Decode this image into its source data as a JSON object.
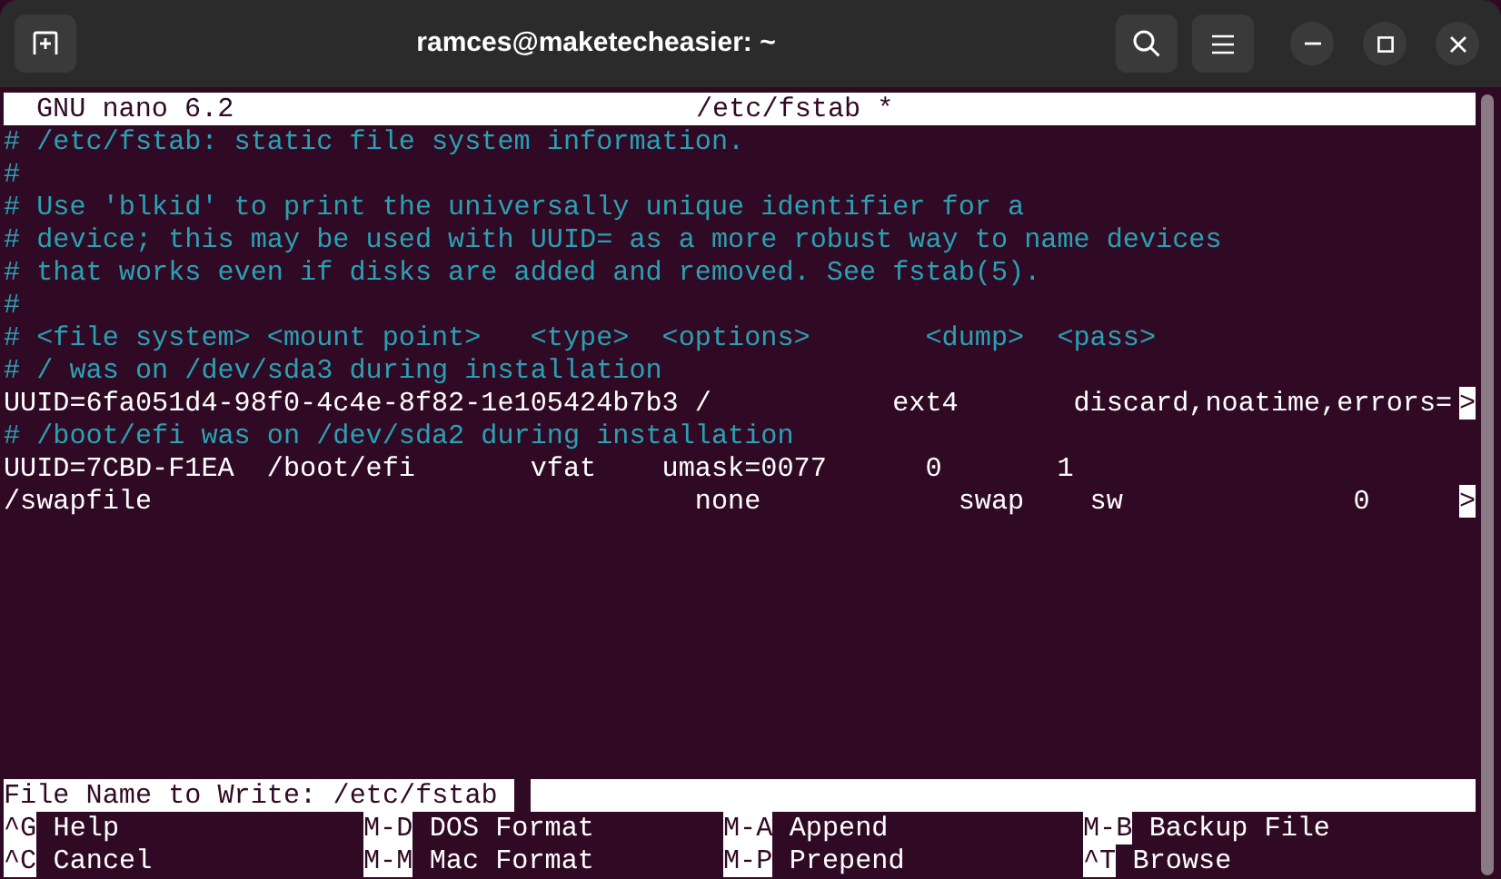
{
  "window": {
    "title": "ramces@maketecheasier: ~"
  },
  "nano": {
    "version": "GNU nano 6.2",
    "filename": "/etc/fstab *"
  },
  "lines": [
    {
      "kind": "comment",
      "text": "# /etc/fstab: static file system information."
    },
    {
      "kind": "comment",
      "text": "#"
    },
    {
      "kind": "comment",
      "text": "# Use 'blkid' to print the universally unique identifier for a"
    },
    {
      "kind": "comment",
      "text": "# device; this may be used with UUID= as a more robust way to name devices"
    },
    {
      "kind": "comment",
      "text": "# that works even if disks are added and removed. See fstab(5)."
    },
    {
      "kind": "comment",
      "text": "#"
    },
    {
      "kind": "comment",
      "text": "# <file system> <mount point>   <type>  <options>       <dump>  <pass>"
    },
    {
      "kind": "comment",
      "text": "# / was on /dev/sda3 during installation"
    },
    {
      "kind": "plain",
      "text": "UUID=6fa051d4-98f0-4c4e-8f82-1e105424b7b3 /           ext4       discard,noatime,errors=",
      "overflow_mark": ">"
    },
    {
      "kind": "comment",
      "text": "# /boot/efi was on /dev/sda2 during installation"
    },
    {
      "kind": "plain",
      "text": "UUID=7CBD-F1EA  /boot/efi       vfat    umask=0077      0       1"
    },
    {
      "kind": "plain",
      "text": "/swapfile                                 none            swap    sw              0",
      "overflow_mark": ">"
    }
  ],
  "prompt": {
    "label": "File Name to Write:",
    "value": "/etc/fstab"
  },
  "shortcuts": [
    {
      "key": "^G",
      "label": "Help"
    },
    {
      "key": "M-D",
      "label": "DOS Format"
    },
    {
      "key": "M-A",
      "label": "Append"
    },
    {
      "key": "M-B",
      "label": "Backup File"
    },
    {
      "key": "^C",
      "label": "Cancel"
    },
    {
      "key": "M-M",
      "label": "Mac Format"
    },
    {
      "key": "M-P",
      "label": "Prepend"
    },
    {
      "key": "^T",
      "label": "Browse"
    }
  ]
}
